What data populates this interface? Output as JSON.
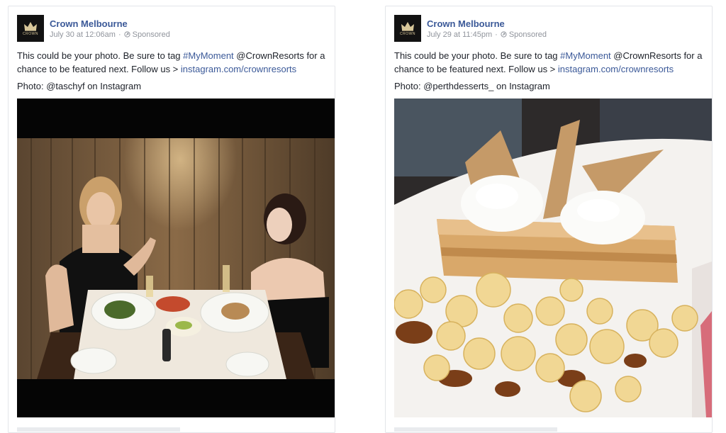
{
  "posts": [
    {
      "page_name": "Crown Melbourne",
      "logo_text": "CROWN",
      "timestamp": "July 30 at 12:06am",
      "sponsored": "Sponsored",
      "caption_pre": "This could be your photo. Be sure to tag ",
      "hashtag": "#MyMoment",
      "caption_mid": " @CrownResorts for a chance to be featured next. Follow us > ",
      "link": "instagram.com/crownresorts",
      "credit": "Photo: @taschyf on Instagram",
      "photo_subject": "two-women-dining-photo"
    },
    {
      "page_name": "Crown Melbourne",
      "logo_text": "CROWN",
      "timestamp": "July 29 at 11:45pm",
      "sponsored": "Sponsored",
      "caption_pre": "This could be your photo. Be sure to tag ",
      "hashtag": "#MyMoment",
      "caption_mid": " @CrownResorts for a chance to be featured next. Follow us > ",
      "link": "instagram.com/crownresorts",
      "credit": "Photo: @perthdesserts_ on Instagram",
      "photo_subject": "caramel-dessert-popcorn-photo"
    }
  ],
  "colors": {
    "link": "#3b5998",
    "text": "#1d2129",
    "meta": "#90949c",
    "logo_bg": "#121212"
  }
}
